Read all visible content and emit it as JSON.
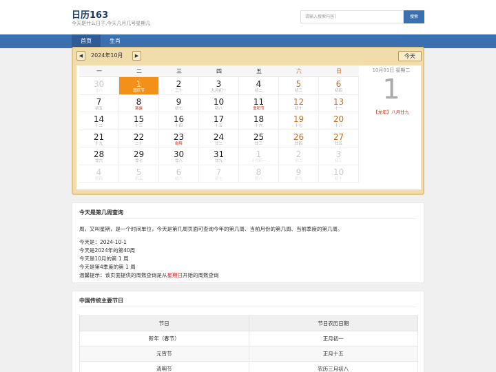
{
  "header": {
    "logo": "日历163",
    "tagline": "今天是什么日子,今天几月几号星期几",
    "search_placeholder": "请输入搜索内容！",
    "search_button": "搜索"
  },
  "nav": [
    {
      "label": "首页",
      "active": true
    },
    {
      "label": "生肖",
      "active": false
    }
  ],
  "calendar": {
    "prev": "◀",
    "next": "▶",
    "year_month": "2024年10月",
    "today_button": "今天",
    "weekdays": [
      "一",
      "二",
      "三",
      "四",
      "五",
      "六",
      "日"
    ],
    "weeks": [
      [
        {
          "d": "30",
          "l": "廿八",
          "o": true
        },
        {
          "d": "1",
          "l": "国庆节",
          "sel": true,
          "hl": true
        },
        {
          "d": "2",
          "l": "三十"
        },
        {
          "d": "3",
          "l": "九月初一"
        },
        {
          "d": "4",
          "l": "初二"
        },
        {
          "d": "5",
          "l": "初三"
        },
        {
          "d": "6",
          "l": "初四"
        }
      ],
      [
        {
          "d": "7",
          "l": "初五"
        },
        {
          "d": "8",
          "l": "寒露",
          "hl": true
        },
        {
          "d": "9",
          "l": "初七"
        },
        {
          "d": "10",
          "l": "初八"
        },
        {
          "d": "11",
          "l": "重阳节",
          "hl": true
        },
        {
          "d": "12",
          "l": "初十"
        },
        {
          "d": "13",
          "l": "十一"
        }
      ],
      [
        {
          "d": "14",
          "l": "十二"
        },
        {
          "d": "15",
          "l": "十三"
        },
        {
          "d": "16",
          "l": "十四"
        },
        {
          "d": "17",
          "l": "十五"
        },
        {
          "d": "18",
          "l": "十六"
        },
        {
          "d": "19",
          "l": "十七"
        },
        {
          "d": "20",
          "l": "十八"
        }
      ],
      [
        {
          "d": "21",
          "l": "十九"
        },
        {
          "d": "22",
          "l": "二十"
        },
        {
          "d": "23",
          "l": "霜降",
          "hl": true
        },
        {
          "d": "24",
          "l": "廿二"
        },
        {
          "d": "25",
          "l": "廿三"
        },
        {
          "d": "26",
          "l": "廿四"
        },
        {
          "d": "27",
          "l": "廿五"
        }
      ],
      [
        {
          "d": "28",
          "l": "廿六"
        },
        {
          "d": "29",
          "l": "廿七"
        },
        {
          "d": "30",
          "l": "廿八"
        },
        {
          "d": "31",
          "l": "廿九"
        },
        {
          "d": "1",
          "l": "十月初一",
          "o": true
        },
        {
          "d": "2",
          "l": "初二",
          "o": true
        },
        {
          "d": "3",
          "l": "初三",
          "o": true
        }
      ],
      [
        {
          "d": "4",
          "l": "初四",
          "o": true
        },
        {
          "d": "5",
          "l": "初五",
          "o": true
        },
        {
          "d": "6",
          "l": "初六",
          "o": true
        },
        {
          "d": "7",
          "l": "初七",
          "o": true
        },
        {
          "d": "8",
          "l": "初八",
          "o": true
        },
        {
          "d": "9",
          "l": "初九",
          "o": true
        },
        {
          "d": "10",
          "l": "初十",
          "o": true
        }
      ]
    ],
    "side": {
      "date": "10月01日 星期二",
      "day": "1",
      "lunar": "【龙年】八月廿九"
    }
  },
  "week_query": {
    "title": "今天是第几周查询",
    "intro": "周，又叫星期，是一个时间单位，今天是第几周页面可查询今年的第几周、当前月份的第几周、当前季度的第几周。",
    "today": "今天是：2024-10-1",
    "year_week": "今天是2024年的第40周",
    "month_week": "今天是10月的第 1 周",
    "quarter_week": "今天是第4季度的第 1 周",
    "tip_prefix": "温馨提示：该页面提供的周数查询是从",
    "tip_highlight": "星期日",
    "tip_suffix": "开始的周数查询"
  },
  "festivals": {
    "title": "中国传统主要节日",
    "headers": [
      "节日",
      "节日农历日期"
    ],
    "rows": [
      [
        "新年（春节）",
        "正月初一"
      ],
      [
        "元宵节",
        "正月十五"
      ],
      [
        "清明节",
        "农历三月初八"
      ]
    ]
  },
  "colors": {
    "accent": "#3a6fb0",
    "selected": "#f39019",
    "holiday": "#c53d1a",
    "weekend": "#d46a1c"
  }
}
